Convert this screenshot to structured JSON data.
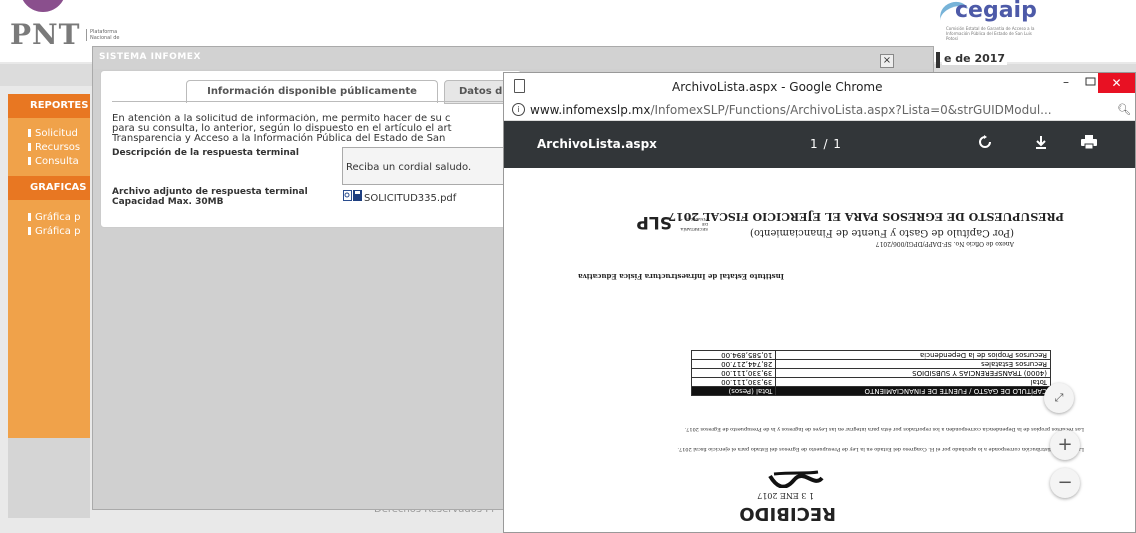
{
  "portal": {
    "logo_text": "PNT",
    "logo_sub": "Plataforma Nacional de",
    "partner_logo": "cegaip",
    "partner_sub": "Comisión Estatal de Garantía de Acceso a la Información Pública del Estado de San Luis Potosí",
    "date_text": "e de 2017",
    "footer": "Derechos Reservados Pl",
    "sidebar": {
      "reportes_header": "REPORTES",
      "reportes_items": [
        "Solicitud",
        "Recursos",
        "Consulta"
      ],
      "graficas_header": "GRAFICAS",
      "graficas_items": [
        "Gráfica p",
        "Gráfica p"
      ]
    }
  },
  "infomex": {
    "title": "SISTEMA INFOMEX",
    "close_label": "×",
    "tabs": [
      {
        "label": "Información disponible públicamente",
        "active": true
      },
      {
        "label": "Datos d",
        "active": false
      }
    ],
    "intro_lines": [
      "En atención a la solicitud de información, me permito hacer de su c",
      "para su consulta, lo anterior, según lo dispuesto en el artículo el art",
      "Transparencia y Acceso a la Información Pública del Estado de San"
    ],
    "description_label": "Descripción de la respuesta terminal",
    "description_value": "Reciba un cordial saludo.",
    "attachment_label": "Archivo adjunto de respuesta terminal",
    "attachment_capacity": "Capacidad Max. 30MB",
    "attachment_file": "SOLICITUD335.pdf"
  },
  "chrome": {
    "window_title": "ArchivoLista.aspx - Google Chrome",
    "url_domain": "www.infomexslp.mx",
    "url_path": "/InfomexSLP/Functions/ArchivoLista.aspx?Lista=0&strGUIDModul...",
    "minimize_label": "–",
    "close_label": "✕",
    "pdf": {
      "file_name": "ArchivoLista.aspx",
      "page_indicator": "1 / 1",
      "icons": [
        "rotate-icon",
        "download-icon",
        "print-icon"
      ]
    },
    "zoom_controls": {
      "fit_label": "⤢",
      "zoom_in_label": "+",
      "zoom_out_label": "−"
    }
  },
  "scan": {
    "title_line1": "PRESUPUESTO DE EGRESOS PARA EL EJERCICIO FISCAL 2017",
    "title_line2": "(Por Capítulo de Gasto y Fuente de Financiamiento)",
    "annex": "Anexo de Oficio No. SF-DAPP/DPGI/006/2017",
    "institute": "Instituto Estatal de Infraestructura Física Educativa",
    "slp_logo": "SLP",
    "slp_logo_sub": "SECRETARÍA DE FINANZAS",
    "table_header": [
      "CAPÍTULO DE GASTO / FUENTE DE FINANCIAMIENTO",
      "Total (Pesos)"
    ],
    "table_rows": [
      [
        "Total",
        "39,330,111.00"
      ],
      [
        "(4000) TRANSFERENCIAS Y SUBSIDIOS",
        "39,330,111.00"
      ],
      [
        "Recursos Estatales",
        "28,744,217.00"
      ],
      [
        "Recursos Propios de la Dependencia",
        "10,585,894.00"
      ]
    ],
    "para1": "La presente distribución corresponde a lo aprobado por el H. Congreso del Estado en la Ley de Presupuesto de Egresos del Estado para el ejercicio fiscal 2017.",
    "para2": "Los recursos propios de la Dependencia corresponden a los reportados por ésta para integrar en las Leyes de Ingresos y la de Presupuesto de Egresos 2017.",
    "stamp_word": "RECIBIDO",
    "stamp_date": "1 3 ENE 2017"
  }
}
